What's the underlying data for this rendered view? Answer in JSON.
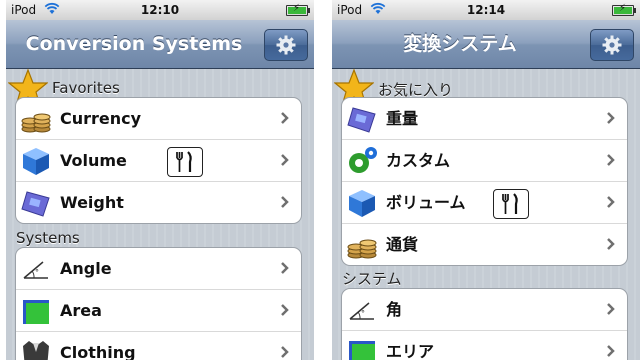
{
  "left": {
    "status": {
      "carrier": "iPod",
      "time": "12:10"
    },
    "nav": {
      "title": "Conversion Systems",
      "settings_icon": "gear-icon"
    },
    "favorites": {
      "header": "Favorites",
      "items": [
        {
          "label": "Currency",
          "icon": "coins-icon"
        },
        {
          "label": "Volume",
          "icon": "cube-icon",
          "badge": "fork-knife-icon"
        },
        {
          "label": "Weight",
          "icon": "scale-icon"
        }
      ]
    },
    "systems": {
      "header": "Systems",
      "items": [
        {
          "label": "Angle",
          "icon": "angle-icon"
        },
        {
          "label": "Area",
          "icon": "area-icon"
        },
        {
          "label": "Clothing",
          "icon": "jacket-icon"
        }
      ]
    }
  },
  "right": {
    "status": {
      "carrier": "iPod",
      "time": "12:14"
    },
    "nav": {
      "title": "変換システム",
      "settings_icon": "gear-icon"
    },
    "favorites": {
      "header": "お気に入り",
      "items": [
        {
          "label": "重量",
          "icon": "scale-icon"
        },
        {
          "label": "カスタム",
          "icon": "custom-gears-icon"
        },
        {
          "label": "ボリューム",
          "icon": "cube-icon",
          "badge": "fork-knife-icon"
        },
        {
          "label": "通貨",
          "icon": "coins-icon"
        }
      ]
    },
    "systems": {
      "header": "システム",
      "items": [
        {
          "label": "角",
          "icon": "angle-icon"
        },
        {
          "label": "エリア",
          "icon": "area-icon"
        }
      ]
    }
  },
  "colors": {
    "navbar": "#7d94b3",
    "accent_star": "#f2b51a",
    "battery": "#3ab83a"
  }
}
